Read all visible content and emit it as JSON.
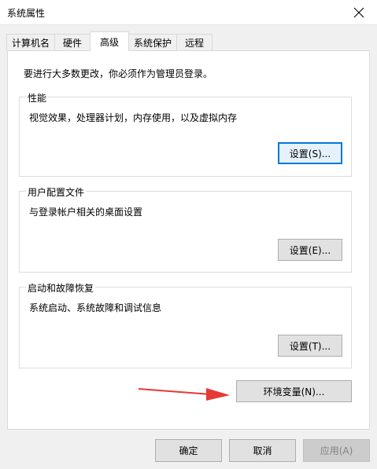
{
  "window": {
    "title": "系统属性"
  },
  "tabs": [
    {
      "label": "计算机名"
    },
    {
      "label": "硬件"
    },
    {
      "label": "高级"
    },
    {
      "label": "系统保护"
    },
    {
      "label": "远程"
    }
  ],
  "advanced": {
    "intro": "要进行大多数更改，你必须作为管理员登录。",
    "performance": {
      "legend": "性能",
      "desc": "视觉效果，处理器计划，内存使用，以及虚拟内存",
      "button": "设置(S)..."
    },
    "user_profiles": {
      "legend": "用户配置文件",
      "desc": "与登录帐户相关的桌面设置",
      "button": "设置(E)..."
    },
    "startup_recovery": {
      "legend": "启动和故障恢复",
      "desc": "系统启动、系统故障和调试信息",
      "button": "设置(T)..."
    },
    "env_button": "环境变量(N)..."
  },
  "footer": {
    "ok": "确定",
    "cancel": "取消",
    "apply": "应用(A)"
  },
  "colors": {
    "accent": "#0078d7",
    "arrow": "#e53935"
  }
}
